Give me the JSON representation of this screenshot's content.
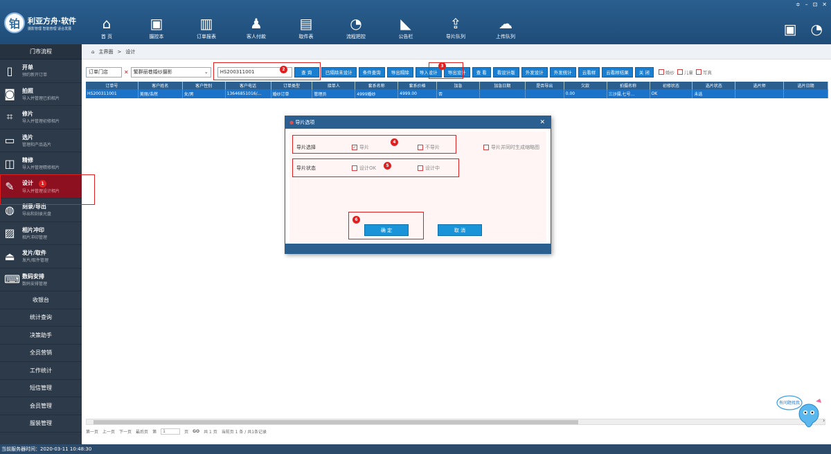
{
  "app": {
    "name": "利亚方舟·软件",
    "tagline": "摄影管理 智能管理 适合发展",
    "logo_char": "铂"
  },
  "window_controls": [
    "≑",
    "–",
    "⊡",
    "✕"
  ],
  "nav": [
    {
      "label": "首 页",
      "icon": "home-icon",
      "glyph": "⌂"
    },
    {
      "label": "摄控本",
      "icon": "notebook-icon",
      "glyph": "▣"
    },
    {
      "label": "订单报表",
      "icon": "chart-icon",
      "glyph": "▥"
    },
    {
      "label": "客人付款",
      "icon": "people-icon",
      "glyph": "♟"
    },
    {
      "label": "取件表",
      "icon": "clipboard-icon",
      "glyph": "▤"
    },
    {
      "label": "流程把控",
      "icon": "signal-icon",
      "glyph": "◔"
    },
    {
      "label": "公告栏",
      "icon": "megaphone-icon",
      "glyph": "◣"
    },
    {
      "label": "导片队列",
      "icon": "upload-box-icon",
      "glyph": "⇪"
    },
    {
      "label": "上传队列",
      "icon": "cloud-upload-icon",
      "glyph": "☁"
    }
  ],
  "sidebar": {
    "header": "门市流程",
    "items": [
      {
        "title": "开单",
        "sub": "预约新开订单",
        "icon": "document-icon",
        "glyph": "▯"
      },
      {
        "title": "拍照",
        "sub": "导入并管理已拍相片",
        "icon": "camera-icon",
        "glyph": "◙"
      },
      {
        "title": "修片",
        "sub": "导入并管理初修相片",
        "icon": "crop-icon",
        "glyph": "⌗"
      },
      {
        "title": "选片",
        "sub": "管理和产品选片",
        "icon": "select-icon",
        "glyph": "▭"
      },
      {
        "title": "精修",
        "sub": "导入并管理精修相片",
        "icon": "retouch-icon",
        "glyph": "◫"
      },
      {
        "title": "设计",
        "sub": "导入并管理设计相片",
        "icon": "brush-icon",
        "glyph": "✎",
        "active": true,
        "marker": "1"
      },
      {
        "title": "刻录/导出",
        "sub": "导出和刻录光盘",
        "icon": "disc-icon",
        "glyph": "◍"
      },
      {
        "title": "相片冲印",
        "sub": "相片冲印管理",
        "icon": "photo-icon",
        "glyph": "▨"
      },
      {
        "title": "发片/取件",
        "sub": "发片/取件管理",
        "icon": "send-icon",
        "glyph": "⏏"
      },
      {
        "title": "数码安排",
        "sub": "数码安排管理",
        "icon": "keyboard-icon",
        "glyph": "⌨"
      }
    ],
    "plain_items": [
      "收银台",
      "统计查询",
      "决策助手",
      "全员营销",
      "工作统计",
      "短信管理",
      "会员管理",
      "服装管理"
    ]
  },
  "breadcrumb": {
    "home": "主界面",
    "sep": ">",
    "current": "设计"
  },
  "toolbar": {
    "store_select": "订单门店",
    "studio_select": "繁群丽巷婚纱摄影",
    "order_input": "HS200311001",
    "marker2": "2",
    "marker3": "3",
    "buttons": [
      "查 询",
      "已隔除未设计",
      "条件查询",
      "导出隔除",
      "导入设计",
      "导出设计",
      "查 看",
      "看设计版",
      "外发设计",
      "外发统计",
      "云看样",
      "云看样结果",
      "关 闭"
    ],
    "checks": [
      "婚纱",
      "儿童",
      "写真"
    ]
  },
  "table": {
    "columns": [
      "订单号",
      "客户姓名",
      "客户性别",
      "客户电话",
      "订单类型",
      "接单人",
      "套系名称",
      "套系价格",
      "加急",
      "加急日期",
      "是否导出",
      "欠款",
      "拍摄名称",
      "初修状态",
      "选片状态",
      "选片师",
      "选片日期"
    ],
    "widths": [
      76,
      64,
      62,
      66,
      60,
      62,
      62,
      56,
      62,
      66,
      56,
      62,
      62,
      62,
      62,
      70,
      64
    ],
    "rows": [
      [
        "HS200311001",
        "美丽/浩然",
        "女/男",
        "13646851016/...",
        "婚纱订单",
        "管理员",
        "4999婚纱",
        "4999.00",
        "否",
        "",
        "",
        "0.00",
        "三沙摄,七号...",
        "OK",
        "未选",
        "",
        ""
      ]
    ]
  },
  "dialog": {
    "title": "导片选项",
    "row1_label": "导片选择",
    "row1_opts": [
      {
        "label": "导片",
        "checked": true
      },
      {
        "label": "不导片",
        "checked": false
      }
    ],
    "row1_extra": "导片并同时生成缩略图",
    "row2_label": "导片状态",
    "row2_opts": [
      {
        "label": "设计OK",
        "checked": false
      },
      {
        "label": "设计中",
        "checked": false
      }
    ],
    "ok": "确 定",
    "cancel": "取 消",
    "markers": [
      "4",
      "5",
      "6"
    ]
  },
  "pager": {
    "first": "第一页",
    "prev": "上一页",
    "next": "下一页",
    "last": "最后页",
    "page_label": "第",
    "page_value": "1",
    "page_suffix": "页",
    "go": "GO",
    "total": "共 1 页",
    "summary": "当前页 1 条 / 共1条记录"
  },
  "status": "当前服务器时间：2020-03-11 10:48:30",
  "mascot_text": "有问题找我"
}
